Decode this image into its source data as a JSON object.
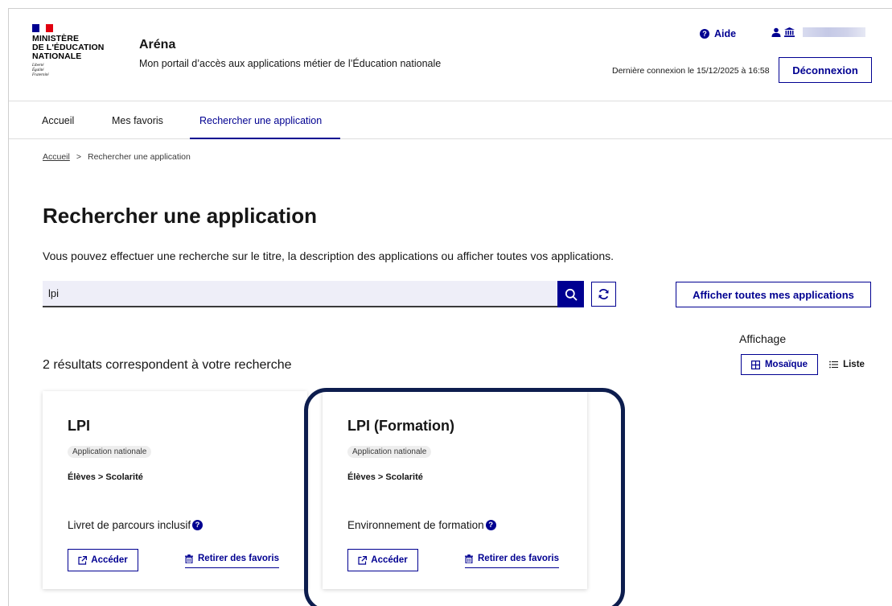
{
  "header": {
    "ministry_lines": [
      "MINISTÈRE",
      "DE L'ÉDUCATION",
      "NATIONALE"
    ],
    "motto_lines": [
      "Liberté",
      "Égalité",
      "Fraternité"
    ],
    "app_title": "Aréna",
    "app_subtitle": "Mon portail d’accès aux applications métier de l’Éducation nationale",
    "help_label": "Aide",
    "last_connection": "Dernière connexion le 15/12/2025 à 16:58",
    "logout_label": "Déconnexion"
  },
  "nav": {
    "items": [
      {
        "label": "Accueil"
      },
      {
        "label": "Mes favoris"
      },
      {
        "label": "Rechercher une application"
      }
    ]
  },
  "breadcrumb": {
    "home": "Accueil",
    "separator": ">",
    "current": "Rechercher une application"
  },
  "main": {
    "title": "Rechercher une application",
    "description": "Vous pouvez effectuer une recherche sur le titre, la description des applications ou afficher toutes vos applications.",
    "search": {
      "value": "lpi"
    },
    "show_all_label": "Afficher toutes mes applications",
    "display": {
      "label": "Affichage",
      "mosaic_label": "Mosaïque",
      "list_label": "Liste"
    },
    "results_text": "2 résultats correspondent à votre recherche",
    "cards": [
      {
        "title": "LPI",
        "badge": "Application nationale",
        "category": "Élèves > Scolarité",
        "description": "Livret de parcours inclusif",
        "access_label": "Accéder",
        "favorite_label": "Retirer des favoris"
      },
      {
        "title": "LPI (Formation)",
        "badge": "Application nationale",
        "category": "Élèves > Scolarité",
        "description": "Environnement de formation",
        "access_label": "Accéder",
        "favorite_label": "Retirer des favoris"
      }
    ]
  },
  "colors": {
    "primary": "#000091",
    "flag_blue": "#000091",
    "flag_red": "#e1000f",
    "highlight_border": "#0d1d4e",
    "search_bg": "#eeeef8"
  },
  "icons": {
    "help": "question-circle-icon",
    "user": "user-icon",
    "institution": "institution-icon",
    "search": "search-icon",
    "refresh": "refresh-icon",
    "mosaic": "grid-icon",
    "list": "list-icon",
    "external": "external-link-icon",
    "trash": "trash-icon"
  }
}
